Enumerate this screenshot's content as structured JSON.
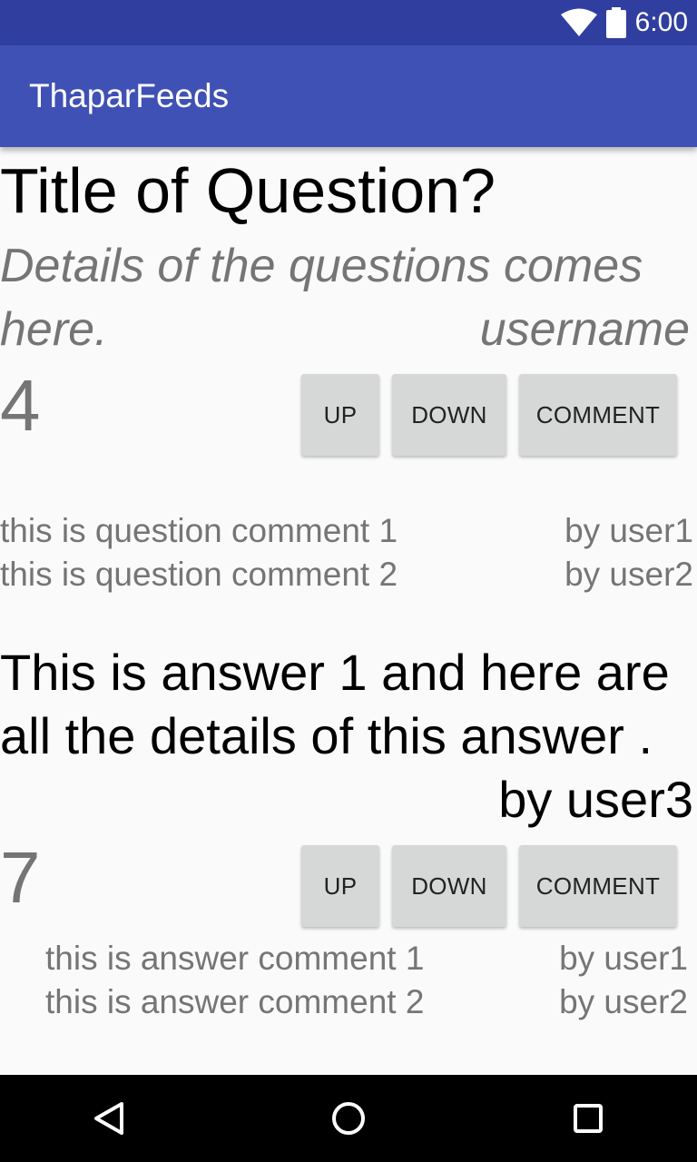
{
  "status_bar": {
    "time": "6:00",
    "icons": [
      "wifi-icon",
      "battery-icon"
    ]
  },
  "app_bar": {
    "title": "ThaparFeeds"
  },
  "question": {
    "title": "Title of Question?",
    "details": "Details of the questions comes here.",
    "username": "username",
    "score": "4",
    "buttons": {
      "up": "UP",
      "down": "DOWN",
      "comment": "COMMENT"
    },
    "comments": [
      {
        "text": "this is question comment 1",
        "by": "by user1"
      },
      {
        "text": "this is question comment 2",
        "by": "by user2"
      }
    ]
  },
  "answer": {
    "text": "This is answer 1 and here are all the details of this answer .",
    "by": "by user3",
    "score": "7",
    "buttons": {
      "up": "UP",
      "down": "DOWN",
      "comment": "COMMENT"
    },
    "comments": [
      {
        "text": "this is answer comment 1",
        "by": "by user1"
      },
      {
        "text": "this is answer comment 2",
        "by": "by user2"
      }
    ]
  },
  "nav_bar": {
    "icons": [
      "back-icon",
      "home-icon",
      "recents-icon"
    ]
  },
  "colors": {
    "status_bar": "#303f9f",
    "app_bar": "#3f51b5",
    "button": "#d6d7d7",
    "secondary_text": "#757575"
  }
}
